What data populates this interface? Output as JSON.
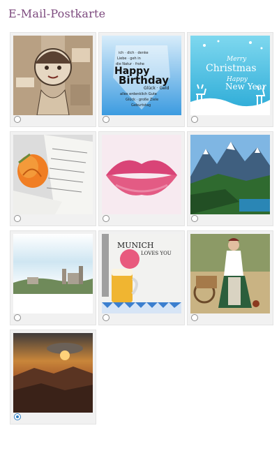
{
  "page": {
    "title": "E-Mail-Postkarte"
  },
  "cards": [
    {
      "motif": "Pop-Art Comic",
      "selected": false
    },
    {
      "motif": "Happy Birthday Word Cloud",
      "selected": false,
      "text": {
        "happy": "Happy",
        "birthday": "Birthday",
        "glueck": "Glück · Geld",
        "gesundheit": "alles erdenklich Gute"
      }
    },
    {
      "motif": "Christmas",
      "selected": false,
      "text": {
        "merry": "Merry",
        "christmas": "Christmas",
        "happy": "Happy",
        "newyear": "New Year"
      }
    },
    {
      "motif": "Rose mit Brief",
      "selected": false
    },
    {
      "motif": "Kussmund",
      "selected": false
    },
    {
      "motif": "Berglandschaft",
      "selected": false
    },
    {
      "motif": "Stadtansicht",
      "selected": false
    },
    {
      "motif": "Munich Loves You",
      "selected": false,
      "text": {
        "munich": "MUNICH",
        "loves": "LOVES YOU"
      }
    },
    {
      "motif": "Trachtenmädchen",
      "selected": false
    },
    {
      "motif": "Sonnenuntergang",
      "selected": true
    }
  ]
}
